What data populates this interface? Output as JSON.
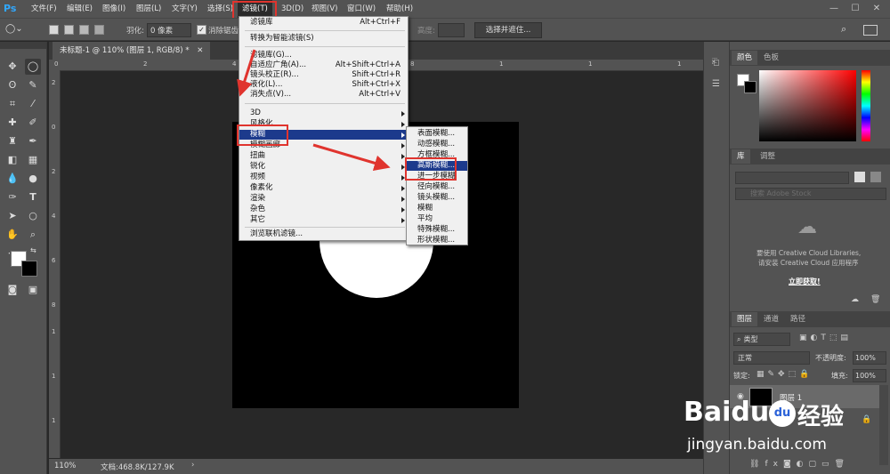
{
  "app": {
    "logo": "Ps"
  },
  "menubar": {
    "items": [
      "文件(F)",
      "编辑(E)",
      "图像(I)",
      "图层(L)",
      "文字(Y)",
      "选择(S)",
      "滤镜(T)",
      "3D(D)",
      "视图(V)",
      "窗口(W)",
      "帮助(H)"
    ],
    "active": "滤镜(T)",
    "window_controls": [
      "—",
      "☐",
      "✕"
    ]
  },
  "options": {
    "feather_label": "羽化:",
    "feather_value": "0 像素",
    "antialias_label": "消除锯齿",
    "height_label": "高度:",
    "select_mask_button": "选择并遮住..."
  },
  "document": {
    "tab_title": "未标题-1 @ 110% (图层 1, RGB/8) *",
    "zoom": "110%",
    "doc_info": "文档:468.8K/127.9K"
  },
  "ruler": {
    "h_ticks": [
      "0",
      "2",
      "4",
      "6",
      "8",
      "1",
      "1",
      "1"
    ],
    "v_ticks": [
      "2",
      "0",
      "2",
      "4",
      "6",
      "8",
      "1",
      "1",
      "1"
    ]
  },
  "filter_menu": {
    "items": [
      {
        "label": "滤镜库",
        "shortcut": "Alt+Ctrl+F"
      },
      {
        "label": "转换为智能滤镜(S)",
        "shortcut": ""
      },
      {
        "label": "滤镜库(G)...",
        "shortcut": ""
      },
      {
        "label": "自适应广角(A)...",
        "shortcut": "Alt+Shift+Ctrl+A"
      },
      {
        "label": "镜头校正(R)...",
        "shortcut": "Shift+Ctrl+R"
      },
      {
        "label": "液化(L)...",
        "shortcut": "Shift+Ctrl+X"
      },
      {
        "label": "消失点(V)...",
        "shortcut": "Alt+Ctrl+V"
      },
      {
        "label": "3D",
        "shortcut": ""
      },
      {
        "label": "风格化",
        "shortcut": ""
      },
      {
        "label": "模糊",
        "shortcut": ""
      },
      {
        "label": "模糊画廊",
        "shortcut": ""
      },
      {
        "label": "扭曲",
        "shortcut": ""
      },
      {
        "label": "锐化",
        "shortcut": ""
      },
      {
        "label": "视频",
        "shortcut": ""
      },
      {
        "label": "像素化",
        "shortcut": ""
      },
      {
        "label": "渲染",
        "shortcut": ""
      },
      {
        "label": "杂色",
        "shortcut": ""
      },
      {
        "label": "其它",
        "shortcut": ""
      },
      {
        "label": "浏览联机滤镜...",
        "shortcut": ""
      }
    ]
  },
  "blur_submenu": {
    "items": [
      "表面模糊...",
      "动感模糊...",
      "方框模糊...",
      "高斯模糊...",
      "进一步模糊",
      "径向模糊...",
      "镜头模糊...",
      "模糊",
      "平均",
      "特殊模糊...",
      "形状模糊..."
    ],
    "highlighted": "高斯模糊..."
  },
  "panels": {
    "color_tabs": [
      "颜色",
      "色板"
    ],
    "library_tabs": [
      "库",
      "调整"
    ],
    "library_search_placeholder": "搜索 Adobe Stock",
    "cc_message_1": "要使用 Creative Cloud Libraries,",
    "cc_message_2": "请安装 Creative Cloud 应用程序",
    "cc_link": "立即获取!",
    "layers_tabs": [
      "图层",
      "通道",
      "路径"
    ],
    "kind_label": "类型",
    "blend_mode": "正常",
    "opacity_label": "不透明度:",
    "opacity_value": "100%",
    "lock_label": "锁定:",
    "fill_label": "填充:",
    "fill_value": "100%",
    "layer_name": "图层 1",
    "fx_label": "fx"
  },
  "watermark": {
    "brand": "Baidu",
    "du": "du",
    "cn": "经验",
    "url": "jingyan.baidu.com"
  },
  "colors": {
    "accent_blue": "#31a8ff",
    "menu_highlight": "#1c3a8c",
    "annotation_red": "#e0342e"
  }
}
